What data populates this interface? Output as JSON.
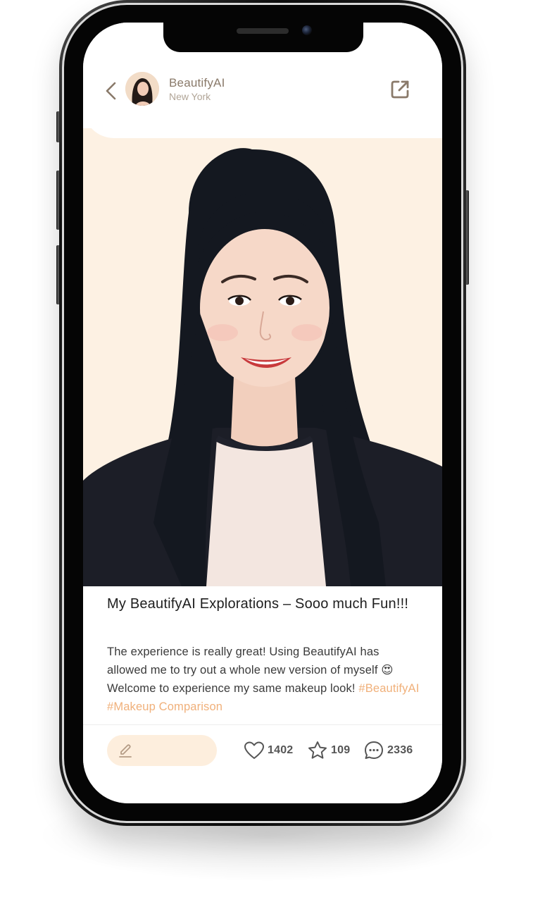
{
  "header": {
    "username": "BeautifyAI",
    "location": "New York"
  },
  "post": {
    "title": "My BeautifyAI Explorations – Sooo much Fun!!!",
    "body_text": "The experience is really great! Using BeautifyAI has allowed me to try out a whole new version of myself 😍 Welcome to experience my same makeup look! ",
    "hashtags": [
      "#BeautifyAI",
      "#Makeup Comparison"
    ]
  },
  "actions": {
    "comment_placeholder": "",
    "likes": "1402",
    "favorites": "109",
    "comments": "2336"
  },
  "icons": {
    "back": "chevron-left-icon",
    "share": "external-link-icon",
    "comment_input": "pencil-icon",
    "like": "heart-icon",
    "favorite": "star-icon",
    "comment": "speech-bubble-icon"
  },
  "colors": {
    "accent": "#f0b07a",
    "photo_background": "#fdf1e3",
    "comment_pill": "#fdeedd",
    "username": "#8a7a6a"
  }
}
